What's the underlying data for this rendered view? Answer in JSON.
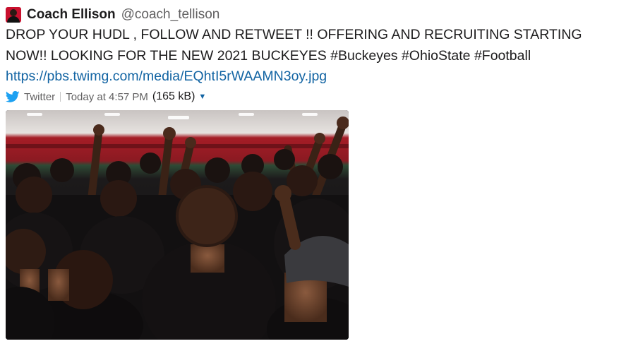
{
  "tweet": {
    "display_name": "Coach Ellison",
    "handle": "@coach_tellison",
    "text_before_link": "DROP YOUR HUDL , FOLLOW AND RETWEET !! OFFERING AND RECRUITING STARTING NOW!! LOOKING FOR THE NEW 2021 BUCKEYES #Buckeyes #OhioState #Football ",
    "link": "https://pbs.twimg.com/media/EQhtI5rWAAMN3oy.jpg"
  },
  "attachment": {
    "source": "Twitter",
    "timestamp": "Today at 4:57 PM",
    "file_size": "(165 kB)",
    "expand_icon": "caret-down-icon"
  },
  "colors": {
    "link": "#1264a3",
    "twitter_blue": "#1da1f2",
    "scarlet": "#c8102e"
  },
  "icons": {
    "avatar": "coach-avatar",
    "source": "twitter-bird-icon"
  }
}
